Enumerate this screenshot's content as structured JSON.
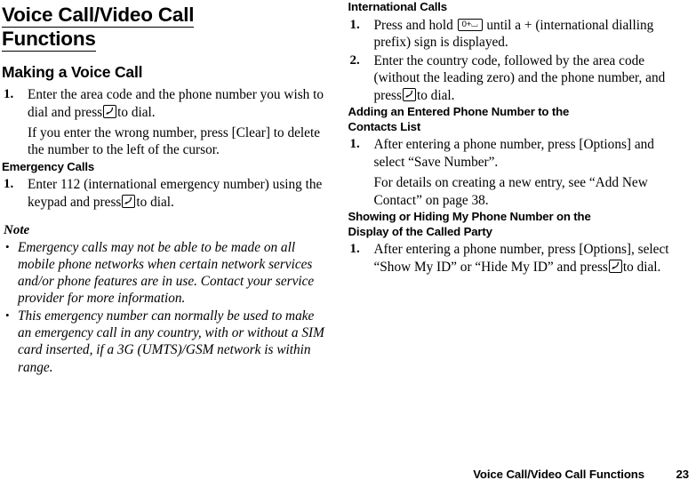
{
  "document": {
    "title_line_1": "Voice Call/Video Call",
    "title_line_2": "Functions"
  },
  "icons": {
    "send_key": "send-key-icon",
    "zero_key_label": "0+⌴"
  },
  "left_column": {
    "section_heading": "Making a Voice Call",
    "steps": [
      {
        "number": "1.",
        "text_before_icon": "Enter the area code and the phone number you wish to dial and press",
        "text_after_icon": "to dial.",
        "extra": "If you enter the wrong number, press [Clear] to delete the number to the left of the cursor."
      }
    ],
    "sub_heading": "Emergency Calls",
    "sub_steps": [
      {
        "number": "1.",
        "text_before_icon": "Enter 112 (international emergency number) using the keypad and press",
        "text_after_icon": "to dial."
      }
    ],
    "note_label": "Note",
    "note_bullet": "•",
    "notes": [
      "Emergency calls may not be able to be made on all mobile phone networks when certain network services and/or phone features are in use. Contact your service provider for more information.",
      "This emergency number can normally be used to make an emergency call in any country, with or without a SIM card inserted, if a 3G (UMTS)/GSM network is within range."
    ]
  },
  "right_column": {
    "sections": [
      {
        "heading": "International Calls",
        "steps": [
          {
            "number": "1.",
            "text_before_icon": "Press and hold",
            "icon": "zero-key",
            "text_after_icon": "until a + (international dialling prefix) sign is displayed."
          },
          {
            "number": "2.",
            "text_before_icon": "Enter the country code, followed by the area code (without the leading zero) and the phone number, and press",
            "icon": "send-key",
            "text_after_icon": "to dial."
          }
        ]
      },
      {
        "heading_line_1": "Adding an Entered Phone Number to the",
        "heading_line_2": "Contacts List",
        "steps": [
          {
            "number": "1.",
            "text": "After entering a phone number, press [Options] and select “Save Number”.",
            "extra": "For details on creating a new entry, see “Add New Contact” on page 38."
          }
        ]
      },
      {
        "heading_line_1": "Showing or Hiding My Phone Number on the",
        "heading_line_2": "Display of the Called Party",
        "steps": [
          {
            "number": "1.",
            "text_before_icon": "After entering a phone number, press [Options], select “Show My ID” or “Hide My ID” and press",
            "icon": "send-key",
            "text_after_icon": "to dial."
          }
        ]
      }
    ]
  },
  "footer": {
    "chapter_title": "Voice Call/Video Call Functions",
    "page_number": "23"
  }
}
